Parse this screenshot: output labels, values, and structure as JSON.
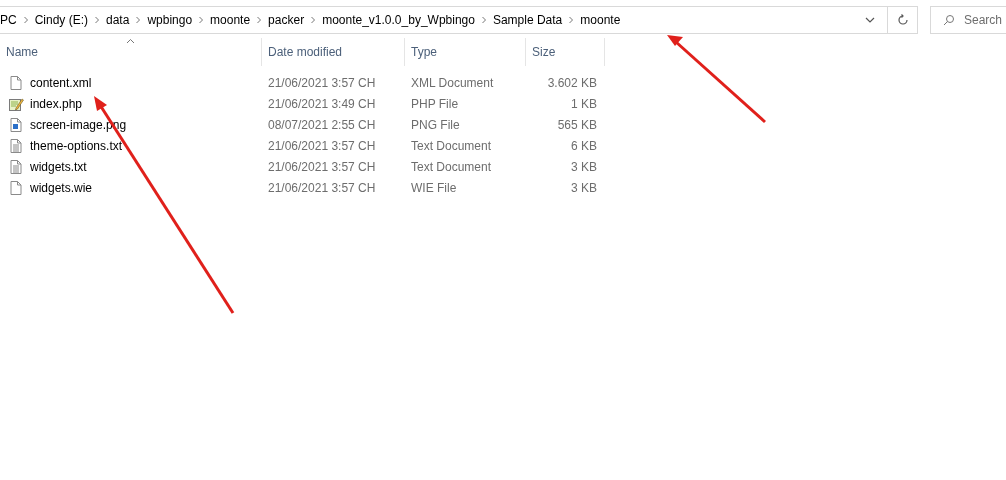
{
  "address_bar": {
    "crumbs": [
      "PC",
      "Cindy (E:)",
      "data",
      "wpbingo",
      "moonte",
      "packer",
      "moonte_v1.0.0_by_Wpbingo",
      "Sample Data",
      "moonte"
    ]
  },
  "search": {
    "placeholder": "Search"
  },
  "table": {
    "columns": [
      "Name",
      "Date modified",
      "Type",
      "Size"
    ],
    "rows": [
      {
        "kind": "blank",
        "name": "content.xml",
        "date": "21/06/2021 3:57 CH",
        "type": "XML Document",
        "size": "3.602 KB"
      },
      {
        "kind": "php",
        "name": "index.php",
        "date": "21/06/2021 3:49 CH",
        "type": "PHP File",
        "size": "1 KB"
      },
      {
        "kind": "image",
        "name": "screen-image.png",
        "date": "08/07/2021 2:55 CH",
        "type": "PNG File",
        "size": "565 KB"
      },
      {
        "kind": "text",
        "name": "theme-options.txt",
        "date": "21/06/2021 3:57 CH",
        "type": "Text Document",
        "size": "6 KB"
      },
      {
        "kind": "text",
        "name": "widgets.txt",
        "date": "21/06/2021 3:57 CH",
        "type": "Text Document",
        "size": "3 KB"
      },
      {
        "kind": "blank",
        "name": "widgets.wie",
        "date": "21/06/2021 3:57 CH",
        "type": "WIE File",
        "size": "3 KB"
      }
    ]
  }
}
